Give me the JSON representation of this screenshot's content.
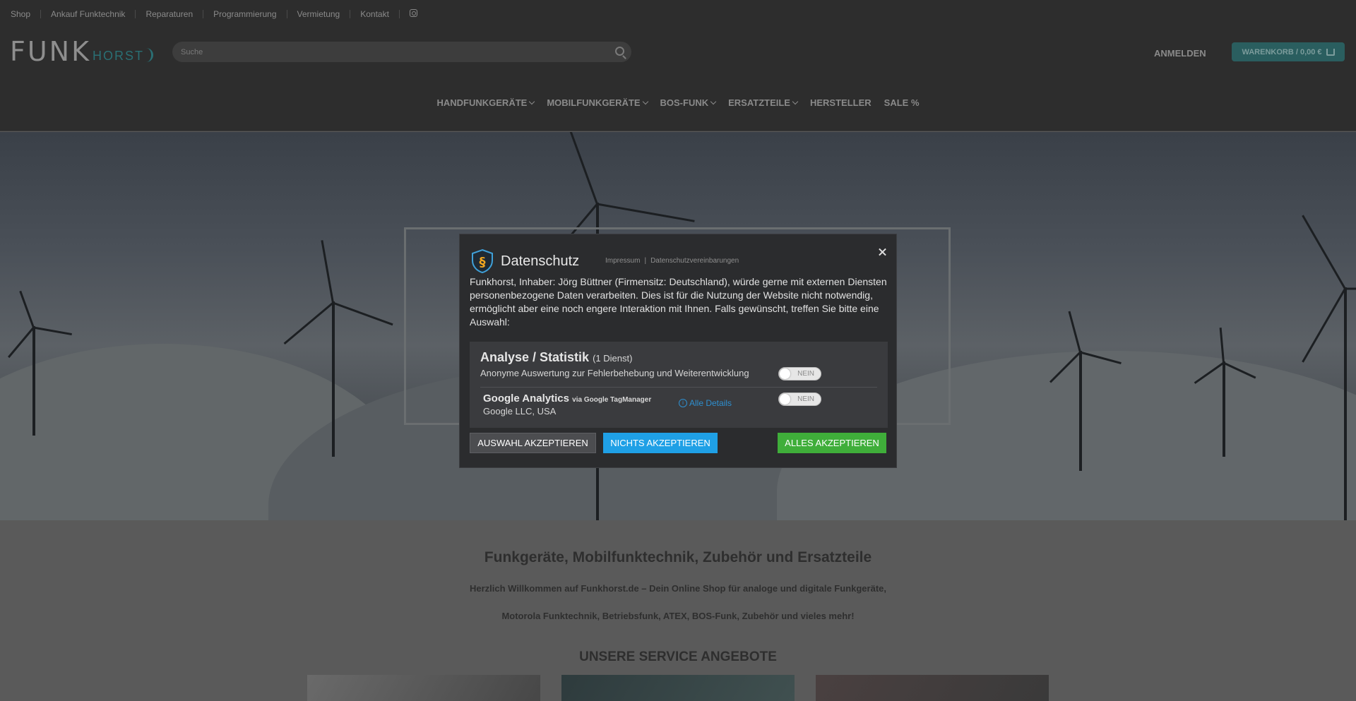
{
  "topbar": {
    "items": [
      "Shop",
      "Ankauf Funktechnik",
      "Reparaturen",
      "Programmierung",
      "Vermietung",
      "Kontakt"
    ],
    "instagram_icon": "instagram-icon"
  },
  "header": {
    "logo_funk": "FUNK",
    "logo_horst": "HORST",
    "search_placeholder": "Suche",
    "login": "ANMELDEN",
    "cart": "WARENKORB / 0,00 €"
  },
  "nav": {
    "items": [
      {
        "label": "HANDFUNKGERÄTE",
        "dropdown": true
      },
      {
        "label": "MOBILFUNKGERÄTE",
        "dropdown": true
      },
      {
        "label": "BOS-FUNK",
        "dropdown": true
      },
      {
        "label": "ERSATZTEILE",
        "dropdown": true
      },
      {
        "label": "HERSTELLER",
        "dropdown": false
      },
      {
        "label": "SALE %",
        "dropdown": false
      }
    ]
  },
  "content": {
    "title": "Funkgeräte, Mobilfunktechnik, Zubehör und Ersatzteile",
    "p1": "Herzlich Willkommen auf Funkhorst.de – Dein Online Shop für analoge und digitale Funkgeräte,",
    "p2": "Motorola Funktechnik, Betriebsfunk, ATEX, BOS-Funk, Zubehör und vieles mehr!",
    "service_title": "UNSERE SERVICE ANGEBOTE"
  },
  "modal": {
    "title": "Datenschutz",
    "links": [
      "Impressum",
      "Datenschutzvereinbarungen"
    ],
    "link_separator": "|",
    "intro": "Funkhorst, Inhaber: Jörg Büttner (Firmensitz: Deutschland), würde gerne mit externen Diensten personenbezogene Daten verarbeiten. Dies ist für die Nutzung der Website nicht notwendig, ermöglicht aber eine noch engere Interaktion mit Ihnen. Falls gewünscht, treffen Sie bitte eine Auswahl:",
    "category": {
      "title": "Analyse / Statistik",
      "count": "(1 Dienst)",
      "description": "Anonyme Auswertung zur Fehlerbehebung und Weiterentwicklung",
      "toggle_label": "NEIN"
    },
    "service": {
      "name": "Google Analytics",
      "via": "via Google TagManager",
      "company": "Google LLC, USA",
      "details": "Alle Details",
      "toggle_label": "NEIN"
    },
    "buttons": {
      "selection": "AUSWAHL AKZEPTIEREN",
      "none": "NICHTS AKZEPTIEREN",
      "all": "ALLES AKZEPTIEREN"
    }
  },
  "colors": {
    "accent_teal": "#2a5e5f",
    "btn_blue": "#1fa0e6",
    "btn_green": "#3fae3a",
    "link_blue": "#2e8fcf"
  }
}
